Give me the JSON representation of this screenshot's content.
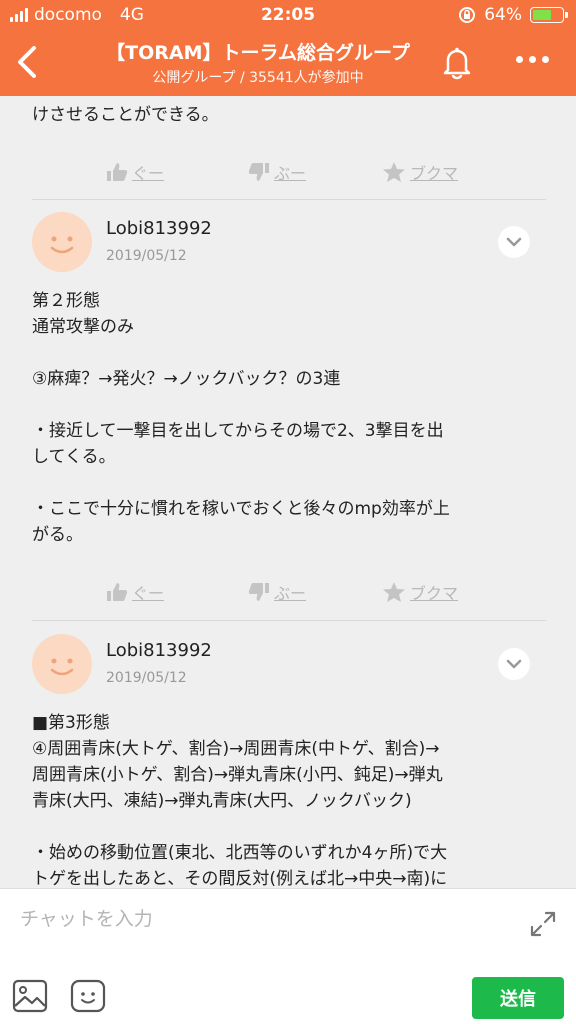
{
  "status_bar": {
    "carrier": "docomo",
    "network": "4G",
    "time": "22:05",
    "battery": "64%",
    "battery_level": 0.64
  },
  "nav": {
    "title": "【TORAM】トーラム総合グループ",
    "subtitle": "公開グループ / 35541人が参加中"
  },
  "top_snippet": "けさせることができる。",
  "reactions": {
    "like": "ぐー",
    "dislike": "ぶー",
    "bookmark": "ブクマ"
  },
  "posts": [
    {
      "user": "Lobi813992",
      "date": "2019/05/12",
      "lines": [
        "第２形態",
        "通常攻撃のみ",
        "",
        "③麻痺？→発火？→ノックバック？の3連",
        "",
        "・接近して一撃目を出してからその場で2、3撃目を出",
        "してくる。",
        "",
        "・ここで十分に慣れを稼いでおくと後々のmp効率が上",
        "がる。"
      ]
    },
    {
      "user": "Lobi813992",
      "date": "2019/05/12",
      "lines": [
        "■第3形態",
        "④周囲青床(大トゲ、割合)→周囲青床(中トゲ、割合)→",
        "周囲青床(小トゲ、割合)→弾丸青床(小円、鈍足)→弾丸",
        "青床(大円、凍結)→弾丸青床(大円、ノックバック)",
        "",
        "・始めの移動位置(東北、北西等のいずれか4ヶ所)で大",
        "トゲを出したあと、その間反対(例えば北→中央→南)に"
      ]
    }
  ],
  "composer": {
    "placeholder": "チャットを入力",
    "send_label": "送信"
  },
  "colors": {
    "header": "#f5733f",
    "send": "#1db94b",
    "avatar": "#fbd9c2"
  }
}
